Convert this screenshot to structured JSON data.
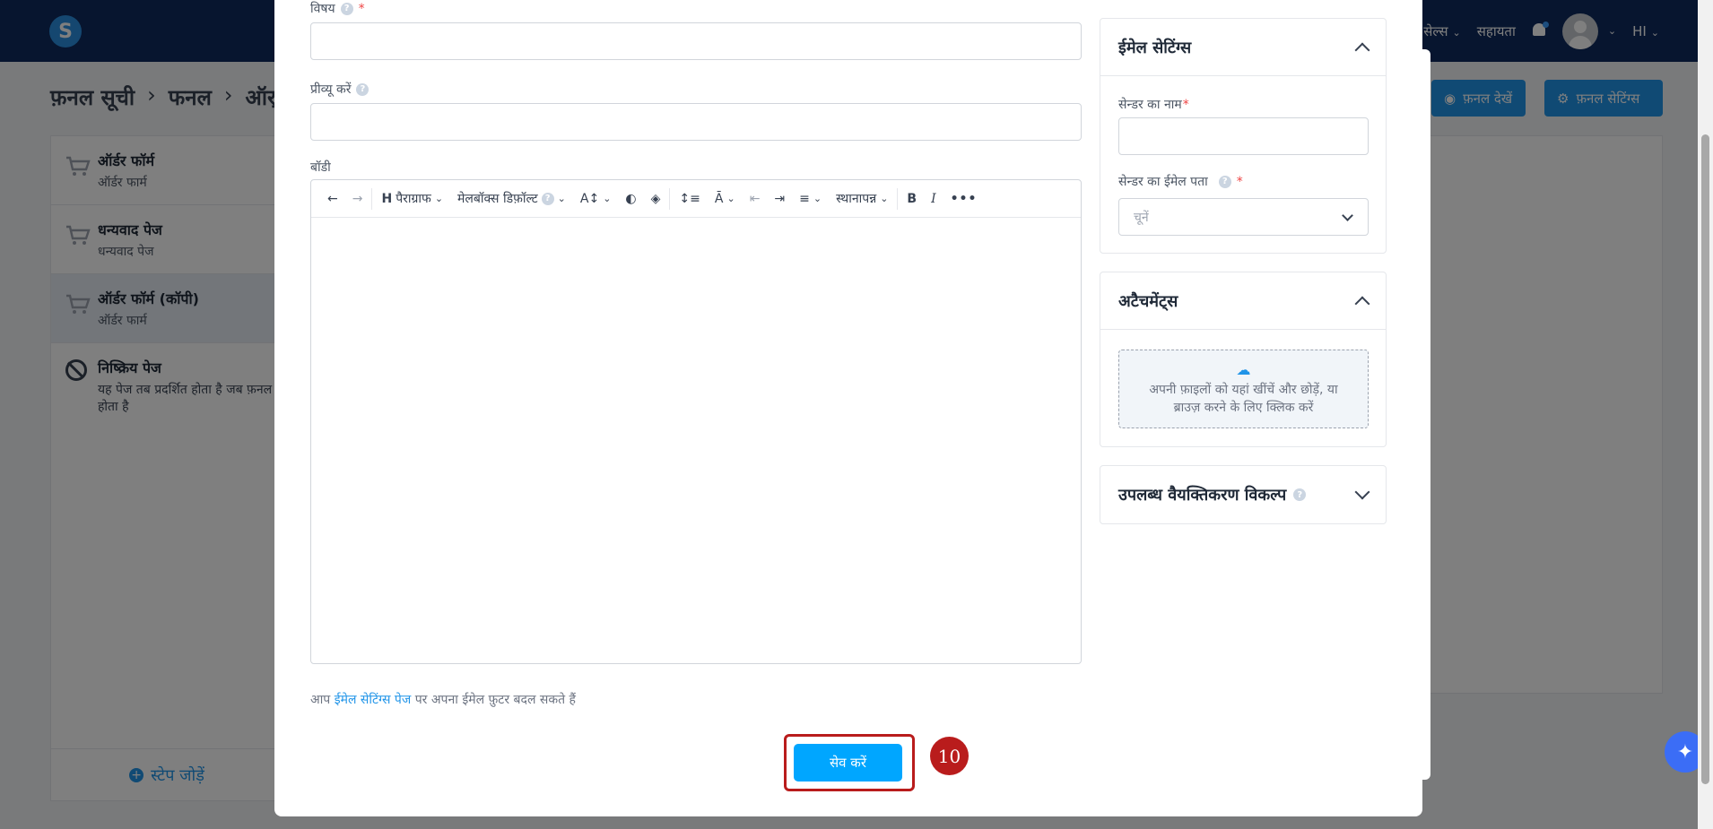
{
  "topbar": {
    "logo": "S",
    "links": [
      "सेल्स",
      "सहायता"
    ],
    "language": "HI"
  },
  "breadcrumb": [
    "फ़नल सूची",
    "फनल",
    "ऑर्"
  ],
  "header_buttons": {
    "view_funnel": "फ़नल देखें",
    "funnel_settings": "फ़नल सेटिंग्स"
  },
  "sidebar": {
    "steps": [
      {
        "title": "ऑर्डर फॉर्म",
        "subtitle": "ऑर्डर फार्म"
      },
      {
        "title": "धन्यवाद पेज",
        "subtitle": "धन्यवाद पेज"
      },
      {
        "title": "ऑर्डर फॉर्म (कॉपी)",
        "subtitle": "ऑर्डर फार्म"
      }
    ],
    "inactive": {
      "title": "निष्क्रिय पेज",
      "line1": "यह पेज तब प्रदर्शित होता है जब फ़नल",
      "line2": "होता है"
    },
    "add_step": "स्टेप जोड़ें"
  },
  "form": {
    "subject_label": "विषय",
    "preview_label": "प्रीव्यू करें",
    "body_label": "बॉडी",
    "toolbar": {
      "heading": "पैराग्राफ",
      "font": "मेलबॉक्स डिफ़ॉल्ट",
      "placeholder": "स्थानापन्न"
    },
    "footer_prefix": "आप",
    "footer_link": "ईमेल सेटिंग्स पेज",
    "footer_suffix": "पर अपना ईमेल फ़ुटर बदल सकते हैं",
    "save_button": "सेव करें"
  },
  "step_badge": "10",
  "email_settings": {
    "title": "ईमेल सेटिंग्स",
    "sender_name_label": "सेन्डर का नाम",
    "sender_email_label": "सेन्डर का ईमेल पता",
    "sender_email_placeholder": "चूनें"
  },
  "attachments": {
    "title": "अटैचमेंट्स",
    "drop_line1": "अपनी फ़ाइलों को यहां खींचें और छोड़ें, या",
    "drop_line2": "ब्राउज़ करने के लिए क्लिक करें"
  },
  "personalization": {
    "title": "उपलब्ध वैयक्तिकरण विकल्प"
  },
  "colors": {
    "primary": "#2094e8",
    "save": "#00a6ff",
    "highlight": "#b91c1c",
    "topbar": "#0e2a5e"
  }
}
